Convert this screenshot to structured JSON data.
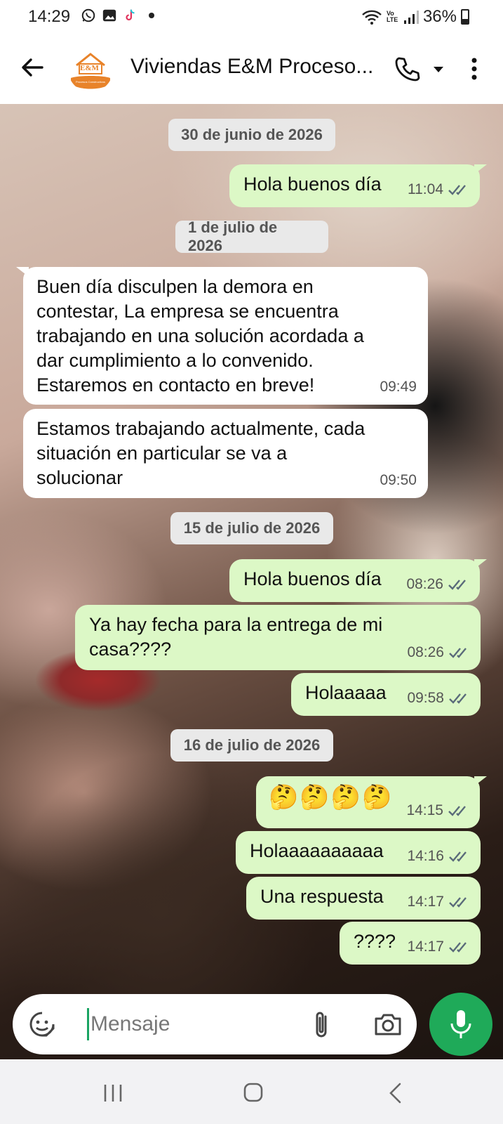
{
  "status_bar": {
    "time": "14:29",
    "battery": "36%",
    "network_label": "Vo LTE",
    "icons": [
      "whatsapp-icon",
      "gallery-icon",
      "tiktok-icon",
      "dot-icon",
      "wifi-icon",
      "volte-icon",
      "signal-icon",
      "battery-icon"
    ]
  },
  "header": {
    "contact_name": "Viviendas E&M Proceso...",
    "avatar_logo_text": "E&M",
    "avatar_caption": "Procesos Constructivos"
  },
  "messages": [
    {
      "type": "date",
      "text": "30 de junio de 2026"
    },
    {
      "type": "out",
      "text": "Hola buenos día",
      "time": "11:04"
    },
    {
      "type": "date",
      "text": "1 de julio de 2026"
    },
    {
      "type": "in",
      "text": "Buen día disculpen la demora en contestar, La empresa se encuentra trabajando en una solución acordada a dar cumplimiento a lo convenido. Estaremos en contacto en breve!",
      "time": "09:49"
    },
    {
      "type": "in",
      "text": "Estamos trabajando actualmente, cada situación en particular se va a solucionar",
      "time": "09:50"
    },
    {
      "type": "date",
      "text": "15 de julio de 2026"
    },
    {
      "type": "out",
      "text": "Hola buenos día",
      "time": "08:26"
    },
    {
      "type": "out",
      "text": "Ya hay fecha para la entrega de mi casa????",
      "time": "08:26"
    },
    {
      "type": "out",
      "text": "Holaaaaa",
      "time": "09:58"
    },
    {
      "type": "date",
      "text": "16 de julio de 2026"
    },
    {
      "type": "out",
      "text": "🤔🤔🤔🤔",
      "time": "14:15"
    },
    {
      "type": "out",
      "text": "Holaaaaaaaaaa",
      "time": "14:16"
    },
    {
      "type": "out",
      "text": "Una respuesta",
      "time": "14:17"
    },
    {
      "type": "out",
      "text": "????",
      "time": "14:17"
    }
  ],
  "composer": {
    "placeholder": "Mensaje"
  },
  "colors": {
    "outgoing_bubble": "#dcf8c6",
    "incoming_bubble": "#ffffff",
    "accent": "#1faa59",
    "tick": "#5a6b7a"
  }
}
